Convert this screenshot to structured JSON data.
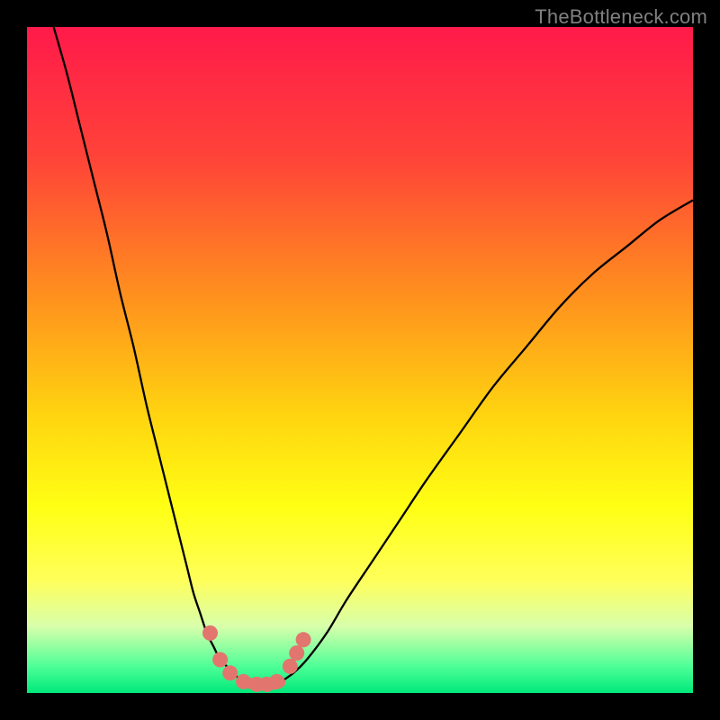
{
  "attribution": "TheBottleneck.com",
  "chart_data": {
    "type": "line",
    "title": "",
    "xlabel": "",
    "ylabel": "",
    "xlim": [
      0,
      100
    ],
    "ylim": [
      0,
      100
    ],
    "series": [
      {
        "name": "left-curve",
        "x": [
          4,
          6,
          8,
          10,
          12,
          14,
          16,
          18,
          20,
          22,
          24,
          25,
          26,
          27,
          28,
          29,
          30,
          31,
          32,
          33
        ],
        "y": [
          100,
          93,
          85,
          77,
          69,
          60,
          52,
          43,
          35,
          27,
          19,
          15,
          12,
          9,
          7,
          5,
          4,
          3,
          2,
          1.6
        ]
      },
      {
        "name": "right-curve",
        "x": [
          38,
          40,
          42,
          45,
          48,
          52,
          56,
          60,
          65,
          70,
          75,
          80,
          85,
          90,
          95,
          100
        ],
        "y": [
          1.6,
          3,
          5,
          9,
          14,
          20,
          26,
          32,
          39,
          46,
          52,
          58,
          63,
          67,
          71,
          74
        ]
      },
      {
        "name": "valley-floor",
        "x": [
          33,
          34,
          35,
          36,
          37,
          38
        ],
        "y": [
          1.6,
          1.3,
          1.2,
          1.2,
          1.3,
          1.6
        ]
      }
    ],
    "markers": {
      "name": "pink-dots",
      "color": "#e2766f",
      "points": [
        {
          "x": 27.5,
          "y": 9
        },
        {
          "x": 29,
          "y": 5
        },
        {
          "x": 30.5,
          "y": 3
        },
        {
          "x": 32.5,
          "y": 1.7
        },
        {
          "x": 34.5,
          "y": 1.3
        },
        {
          "x": 36,
          "y": 1.3
        },
        {
          "x": 37.5,
          "y": 1.7
        },
        {
          "x": 39.5,
          "y": 4
        },
        {
          "x": 40.5,
          "y": 6
        },
        {
          "x": 41.5,
          "y": 8
        }
      ]
    },
    "background_gradient": {
      "stops": [
        {
          "offset": 0.0,
          "color": "#ff1a4a"
        },
        {
          "offset": 0.2,
          "color": "#ff4438"
        },
        {
          "offset": 0.4,
          "color": "#ff8f1e"
        },
        {
          "offset": 0.58,
          "color": "#ffd310"
        },
        {
          "offset": 0.72,
          "color": "#ffff14"
        },
        {
          "offset": 0.83,
          "color": "#ffff5a"
        },
        {
          "offset": 0.9,
          "color": "#d8ffab"
        },
        {
          "offset": 0.96,
          "color": "#4eff97"
        },
        {
          "offset": 1.0,
          "color": "#00e87a"
        }
      ]
    }
  }
}
